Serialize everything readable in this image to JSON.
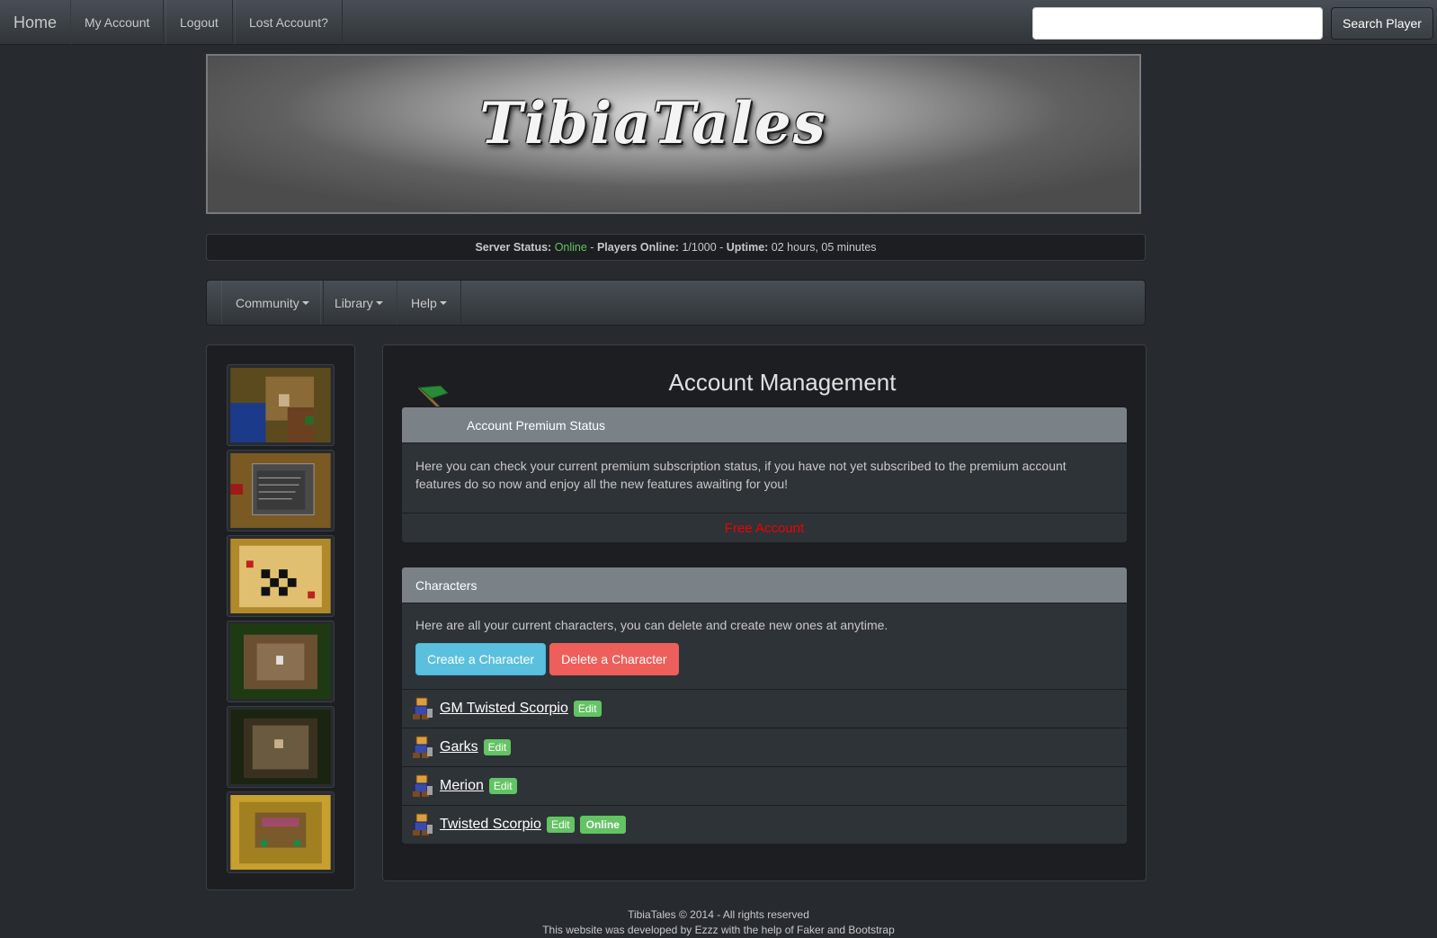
{
  "topnav": {
    "brand": "Home",
    "links": [
      "My Account",
      "Logout",
      "Lost Account?"
    ],
    "search_placeholder": "",
    "search_button": "Search Player"
  },
  "banner": {
    "title": "TibiaTales"
  },
  "status": {
    "server_label": "Server Status:",
    "server_value": "Online",
    "players_label": "Players Online:",
    "players_value": "1/1000",
    "uptime_label": "Uptime:",
    "uptime_value": "02 hours, 05 minutes",
    "online_color": "#62c462"
  },
  "subnav": {
    "items": [
      "Community",
      "Library",
      "Help"
    ]
  },
  "gallery": {
    "count": 6,
    "icon": "game-screenshot-thumbnail"
  },
  "main": {
    "title": "Account Management",
    "premium": {
      "heading": "Account Premium Status",
      "body": "Here you can check your current premium subscription status, if you have not yet subscribed to the premium account features do so now and enjoy all the new features awaiting for you!",
      "status": "Free Account",
      "status_color": "#ee0000"
    },
    "characters": {
      "heading": "Characters",
      "body": "Here are all your current characters, you can delete and create new ones at anytime.",
      "create_button": "Create a Character",
      "delete_button": "Delete a Character",
      "edit_label": "Edit",
      "online_label": "Online",
      "list": [
        {
          "name": "GM Twisted Scorpio",
          "online": false
        },
        {
          "name": "Garks",
          "online": false
        },
        {
          "name": "Merion",
          "online": false
        },
        {
          "name": "Twisted Scorpio",
          "online": true
        }
      ]
    }
  },
  "footer": {
    "line1": "TibiaTales © 2014 - All rights reserved",
    "line2": "This website was developed by Ezzz with the help of Faker and Bootstrap"
  }
}
